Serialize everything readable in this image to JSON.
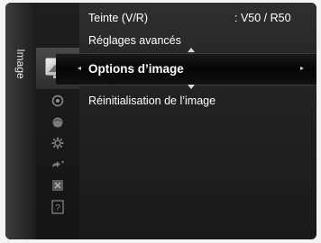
{
  "sidebar": {
    "tab_label": "Image",
    "icons": [
      {
        "name": "picture-icon",
        "glyph": "▭",
        "selected": true
      },
      {
        "name": "sound-icon",
        "glyph": "◉"
      },
      {
        "name": "channel-icon",
        "glyph": "●"
      },
      {
        "name": "setup-icon",
        "glyph": "⚙"
      },
      {
        "name": "input-icon",
        "glyph": "➶"
      },
      {
        "name": "application-icon",
        "glyph": "✱"
      },
      {
        "name": "support-icon",
        "glyph": "?"
      }
    ]
  },
  "menu": {
    "items": [
      {
        "label": "Teinte (V/R)",
        "value": ": V50 / R50"
      },
      {
        "label": "Réglages avancés",
        "value": ""
      },
      {
        "label": "Options d’image",
        "value": "",
        "selected": true
      },
      {
        "label": "Réinitialisation de l’image",
        "value": ""
      }
    ],
    "left_arrow": "◂",
    "right_arrow": "▸"
  }
}
